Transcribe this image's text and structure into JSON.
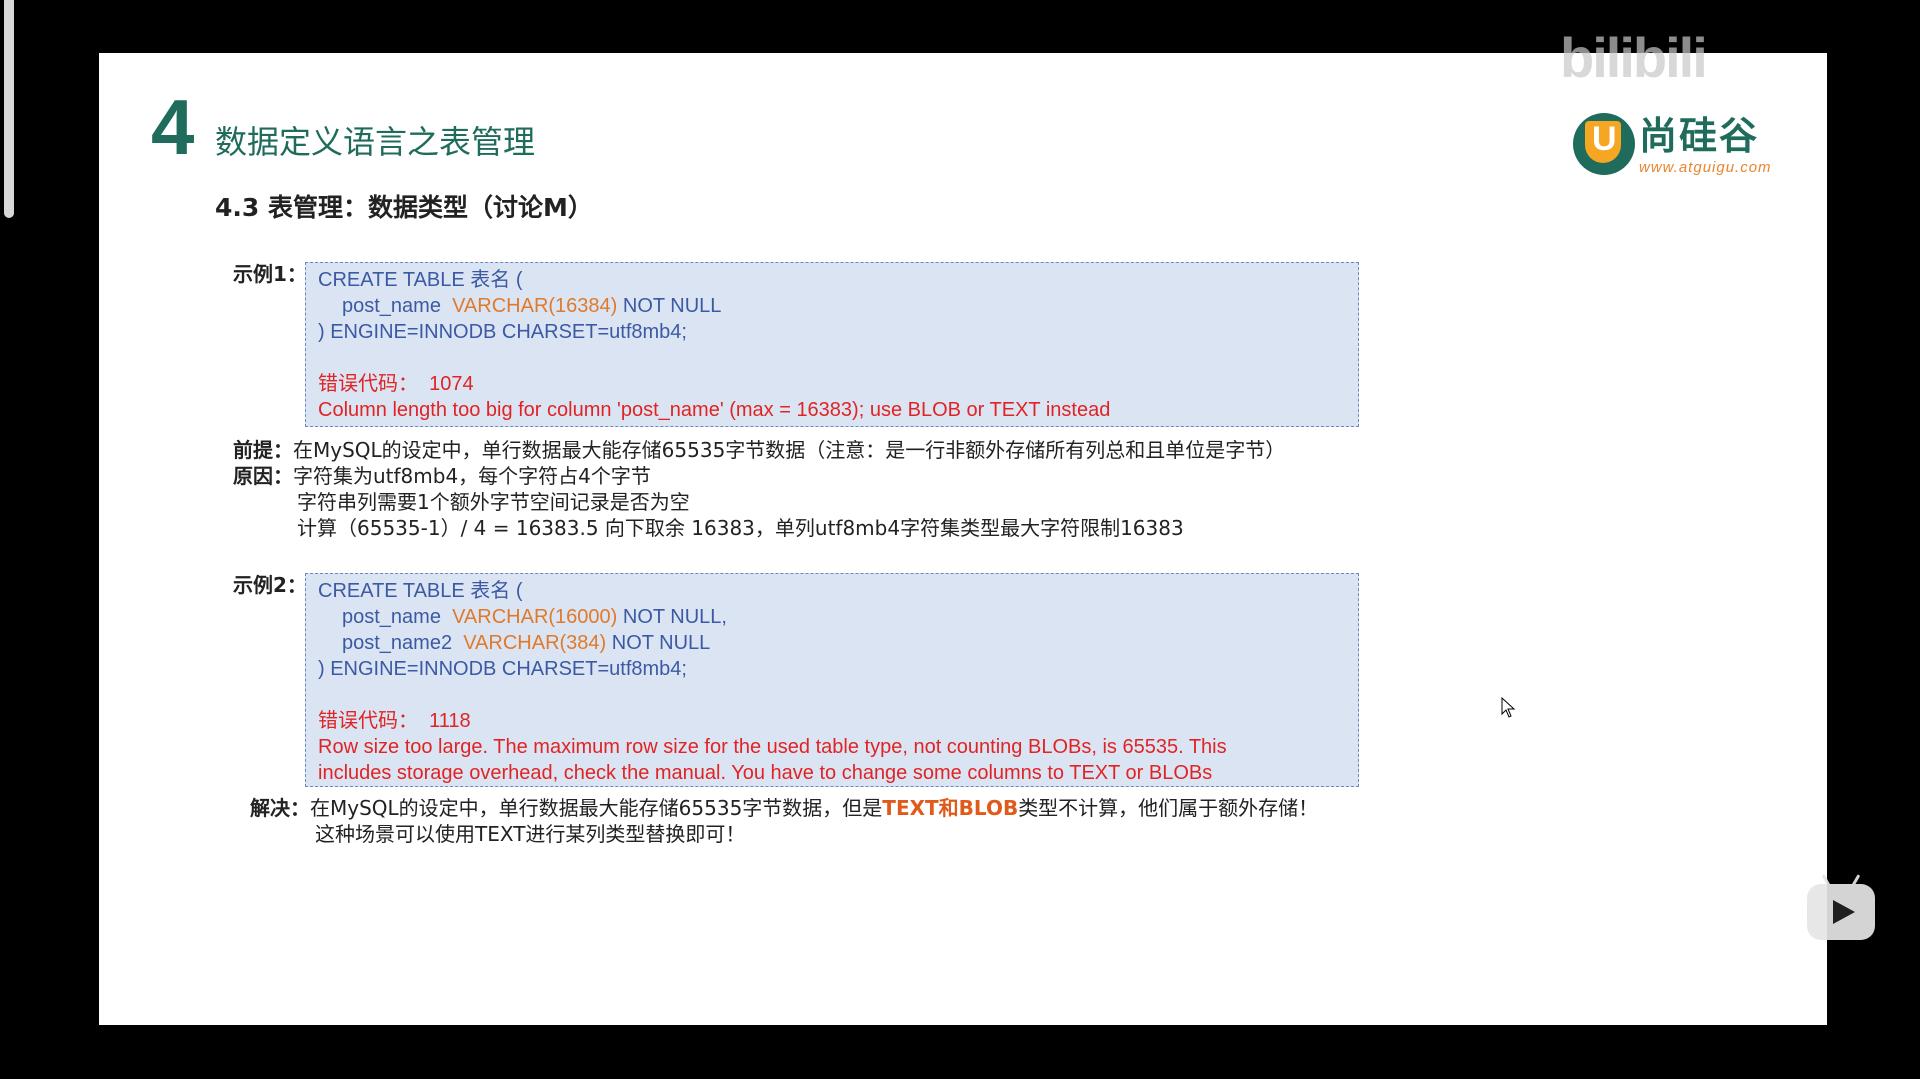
{
  "slide": {
    "chapter_number": "4",
    "chapter_title": "数据定义语言之表管理",
    "subtitle": "4.3 表管理：数据类型（讨论M）"
  },
  "logo": {
    "badge_letter": "U",
    "name": "尚硅谷",
    "url": "www.atguigu.com"
  },
  "watermark": {
    "brand": "bilibili"
  },
  "example1": {
    "label": "示例1：",
    "code": {
      "line1": "CREATE TABLE 表名 (",
      "line2_col": "post_name  ",
      "line2_type": "VARCHAR(16384)",
      "line2_rest": " NOT NULL",
      "line3": ") ENGINE=INNODB CHARSET=utf8mb4;",
      "error_code": "错误代码：  1074",
      "error_msg": "Column length too big for column 'post_name' (max = 16383); use BLOB or TEXT instead"
    }
  },
  "notes": {
    "premise_label": "前提：",
    "premise_text": "在MySQL的设定中，单行数据最大能存储65535字节数据（注意：是一行非额外存储所有列总和且单位是字节）",
    "reason_label": "原因：",
    "reason_line1": "字符集为utf8mb4，每个字符占4个字节",
    "reason_line2": "字符串列需要1个额外字节空间记录是否为空",
    "reason_line3": "计算（65535-1）/ 4 = 16383.5 向下取余 16383，单列utf8mb4字符集类型最大字符限制16383"
  },
  "example2": {
    "label": "示例2：",
    "code": {
      "line1": "CREATE TABLE 表名 (",
      "line2_col": "post_name  ",
      "line2_type": "VARCHAR(16000)",
      "line2_rest": " NOT NULL,",
      "line3_col": "post_name2  ",
      "line3_type": "VARCHAR(384)",
      "line3_rest": " NOT NULL",
      "line4": ") ENGINE=INNODB CHARSET=utf8mb4;",
      "error_code": "错误代码：  1118",
      "error_msg1": "Row size too large. The maximum row size for the used table type, not counting BLOBs, is 65535. This",
      "error_msg2": "includes storage overhead, check the manual. You have to change some columns to TEXT or BLOBs"
    }
  },
  "solution": {
    "label": "解决：",
    "text_before": "在MySQL的设定中，单行数据最大能存储65535字节数据，但是",
    "highlight": "TEXT和BLOB",
    "text_after": "类型不计算，他们属于额外存储！",
    "line2": "这种场景可以使用TEXT进行某列类型替换即可！"
  },
  "player": {
    "play_icon": "play-icon",
    "cursor_icon": "mouse-cursor-icon"
  }
}
